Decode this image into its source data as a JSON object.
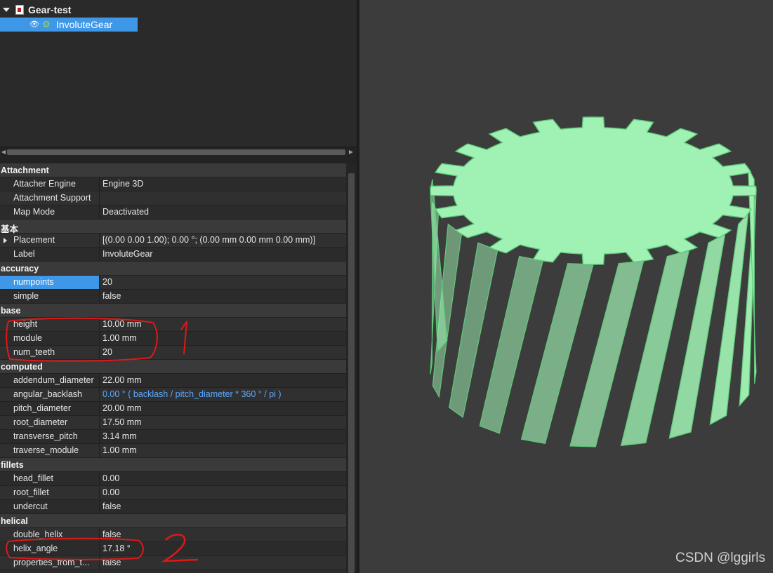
{
  "tree": {
    "root_label": "Gear-test",
    "child_label": "InvoluteGear",
    "icons": {
      "root": "document-icon",
      "visibility": "eye-icon",
      "child": "gear-icon"
    }
  },
  "property_groups": [
    {
      "name": "Attachment",
      "props": [
        {
          "name": "Attacher Engine",
          "value": "Engine 3D"
        },
        {
          "name": "Attachment Support",
          "value": ""
        },
        {
          "name": "Map Mode",
          "value": "Deactivated"
        }
      ]
    },
    {
      "name": "基本",
      "props": [
        {
          "name": "Placement",
          "value": "[(0.00 0.00 1.00); 0.00 °; (0.00 mm  0.00 mm  0.00 mm)]"
        },
        {
          "name": "Label",
          "value": "InvoluteGear"
        }
      ]
    },
    {
      "name": "accuracy",
      "props": [
        {
          "name": "numpoints",
          "value": "20"
        },
        {
          "name": "simple",
          "value": "false"
        }
      ]
    },
    {
      "name": "base",
      "props": [
        {
          "name": "height",
          "value": "10.00 mm"
        },
        {
          "name": "module",
          "value": "1.00 mm"
        },
        {
          "name": "num_teeth",
          "value": "20"
        }
      ]
    },
    {
      "name": "computed",
      "props": [
        {
          "name": "addendum_diameter",
          "value": "22.00 mm"
        },
        {
          "name": "angular_backlash",
          "value": "0.00 °  ( backlash / pitch_diameter * 360 ° / pi )"
        },
        {
          "name": "pitch_diameter",
          "value": "20.00 mm"
        },
        {
          "name": "root_diameter",
          "value": "17.50 mm"
        },
        {
          "name": "transverse_pitch",
          "value": "3.14 mm"
        },
        {
          "name": "traverse_module",
          "value": "1.00 mm"
        }
      ]
    },
    {
      "name": "fillets",
      "props": [
        {
          "name": "head_fillet",
          "value": "0.00"
        },
        {
          "name": "root_fillet",
          "value": "0.00"
        },
        {
          "name": "undercut",
          "value": "false"
        }
      ]
    },
    {
      "name": "helical",
      "props": [
        {
          "name": "double_helix",
          "value": "false"
        },
        {
          "name": "helix_angle",
          "value": "17.18 °"
        },
        {
          "name": "properties_from_t...",
          "value": "false"
        }
      ]
    }
  ],
  "annotations": {
    "mark1": "1",
    "mark2": "2",
    "color": "#e01818"
  },
  "view": {
    "gear_color": "#9ff2b4",
    "edge_color": "#5fc97a",
    "background": "#3c3c3c"
  },
  "watermark": "CSDN @lggirls"
}
